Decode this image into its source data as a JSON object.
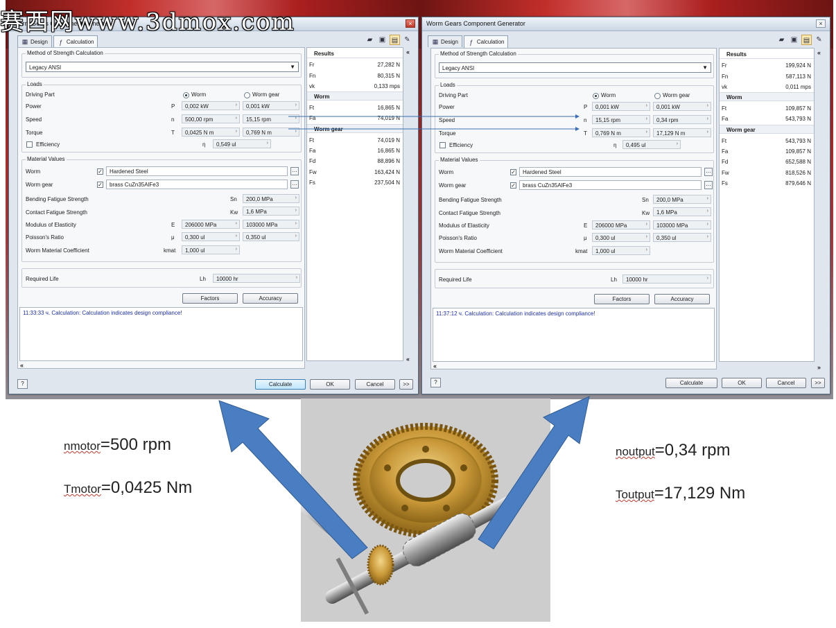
{
  "watermark": "赛西网www.3dmox.com",
  "left_window": {
    "title": "Worm Gears Component Generat",
    "tabs": [
      "Design",
      "Calculation"
    ],
    "method_label": "Method of Strength Calculation",
    "method_value": "Legacy ANSI",
    "loads_label": "Loads",
    "driving_part_label": "Driving Part",
    "radio_worm": "Worm",
    "radio_wormgear": "Worm gear",
    "rows": [
      {
        "label": "Power",
        "sym": "P",
        "v1": "0,002 kW",
        "v2": "0,001 kW"
      },
      {
        "label": "Speed",
        "sym": "n",
        "v1": "500,00 rpm",
        "v2": "15,15 rpm"
      },
      {
        "label": "Torque",
        "sym": "T",
        "v1": "0,0425 N m",
        "v2": "0,769 N m"
      }
    ],
    "efficiency_label": "Efficiency",
    "efficiency_sym": "η",
    "efficiency_value": "0,549 ul",
    "material_label": "Material Values",
    "worm_label": "Worm",
    "worm_material": "Hardened Steel",
    "wormgear_label": "Worm gear",
    "wormgear_material": "brass CuZn35AlFe3",
    "mat_rows": [
      {
        "label": "Bending Fatigue Strength",
        "sym": "Sn",
        "v1": "",
        "v2": "200,0 MPa"
      },
      {
        "label": "Contact Fatigue Strength",
        "sym": "Kw",
        "v1": "",
        "v2": "1,6 MPa"
      },
      {
        "label": "Modulus of Elasticity",
        "sym": "E",
        "v1": "206000 MPa",
        "v2": "103000 MPa"
      },
      {
        "label": "Poisson's Ratio",
        "sym": "μ",
        "v1": "0,300 ul",
        "v2": "0,350 ul"
      },
      {
        "label": "Worm Material Coefficient",
        "sym": "kmat",
        "v1": "1,000 ul",
        "v2": ""
      }
    ],
    "life_label": "Required Life",
    "life_sym": "Lh",
    "life_value": "10000 hr",
    "factors_btn": "Factors",
    "accuracy_btn": "Accuracy",
    "message": "11:33:33 ч. Calculation: Calculation indicates design compliance!",
    "results_title": "Results",
    "results_top": [
      {
        "k": "Fr",
        "v": "27,282 N"
      },
      {
        "k": "Fn",
        "v": "80,315 N"
      },
      {
        "k": "vk",
        "v": "0,133 mps"
      }
    ],
    "worm_head": "Worm",
    "results_worm": [
      {
        "k": "Ft",
        "v": "16,865 N"
      },
      {
        "k": "Fa",
        "v": "74,019 N"
      }
    ],
    "wormgear_head": "Worm gear",
    "results_wormgear": [
      {
        "k": "Ft",
        "v": "74,019 N"
      },
      {
        "k": "Fa",
        "v": "16,865 N"
      },
      {
        "k": "Fd",
        "v": "88,896 N"
      },
      {
        "k": "Fw",
        "v": "163,424 N"
      },
      {
        "k": "Fs",
        "v": "237,504 N"
      }
    ],
    "calculate_btn": "Calculate",
    "ok_btn": "OK",
    "cancel_btn": "Cancel",
    "more_btn": ">>"
  },
  "right_window": {
    "title": "Worm Gears Component Generator",
    "tabs": [
      "Design",
      "Calculation"
    ],
    "method_label": "Method of Strength Calculation",
    "method_value": "Legacy ANSI",
    "loads_label": "Loads",
    "driving_part_label": "Driving Part",
    "radio_worm": "Worm",
    "radio_wormgear": "Worm gear",
    "rows": [
      {
        "label": "Power",
        "sym": "P",
        "v1": "0,001 kW",
        "v2": "0,001 kW"
      },
      {
        "label": "Speed",
        "sym": "n",
        "v1": "15,15 rpm",
        "v2": "0,34 rpm"
      },
      {
        "label": "Torque",
        "sym": "T",
        "v1": "0,769 N m",
        "v2": "17,129 N m"
      }
    ],
    "efficiency_label": "Efficiency",
    "efficiency_sym": "η",
    "efficiency_value": "0,495 ul",
    "material_label": "Material Values",
    "worm_label": "Worm",
    "worm_material": "Hardened Steel",
    "wormgear_label": "Worm gear",
    "wormgear_material": "brass CuZn35AlFe3",
    "mat_rows": [
      {
        "label": "Bending Fatigue Strength",
        "sym": "Sn",
        "v1": "",
        "v2": "200,0 MPa"
      },
      {
        "label": "Contact Fatigue Strength",
        "sym": "Kw",
        "v1": "",
        "v2": "1,6 MPa"
      },
      {
        "label": "Modulus of Elasticity",
        "sym": "E",
        "v1": "206000 MPa",
        "v2": "103000 MPa"
      },
      {
        "label": "Poisson's Ratio",
        "sym": "μ",
        "v1": "0,300 ul",
        "v2": "0,350 ul"
      },
      {
        "label": "Worm Material Coefficient",
        "sym": "kmat",
        "v1": "1,000 ul",
        "v2": ""
      }
    ],
    "life_label": "Required Life",
    "life_sym": "Lh",
    "life_value": "10000 hr",
    "factors_btn": "Factors",
    "accuracy_btn": "Accuracy",
    "message": "11:37:12 ч. Calculation: Calculation indicates design compliance!",
    "results_title": "Results",
    "results_top": [
      {
        "k": "Fr",
        "v": "199,924 N"
      },
      {
        "k": "Fn",
        "v": "587,113 N"
      },
      {
        "k": "vk",
        "v": "0,011 mps"
      }
    ],
    "worm_head": "Worm",
    "results_worm": [
      {
        "k": "Ft",
        "v": "109,857 N"
      },
      {
        "k": "Fa",
        "v": "543,793 N"
      }
    ],
    "wormgear_head": "Worm gear",
    "results_wormgear": [
      {
        "k": "Ft",
        "v": "543,793 N"
      },
      {
        "k": "Fa",
        "v": "109,857 N"
      },
      {
        "k": "Fd",
        "v": "652,588 N"
      },
      {
        "k": "Fw",
        "v": "818,526 N"
      },
      {
        "k": "Fs",
        "v": "879,646 N"
      }
    ],
    "calculate_btn": "Calculate",
    "ok_btn": "OK",
    "cancel_btn": "Cancel",
    "more_btn": ">>"
  },
  "annotations": {
    "n_motor_sub": "nmotor",
    "n_motor_val": "=500 rpm",
    "t_motor_sub": "Tmotor",
    "t_motor_val": "=0,0425 Nm",
    "n_output_sub": "noutput",
    "n_output_val": "=0,34 rpm",
    "t_output_sub": "Toutput",
    "t_output_val": "=17,129 Nm"
  },
  "colors": {
    "arrow_blue": "#4a7ec2",
    "message_blue": "#1b2fa3",
    "gear_gold": "#c9a040"
  }
}
